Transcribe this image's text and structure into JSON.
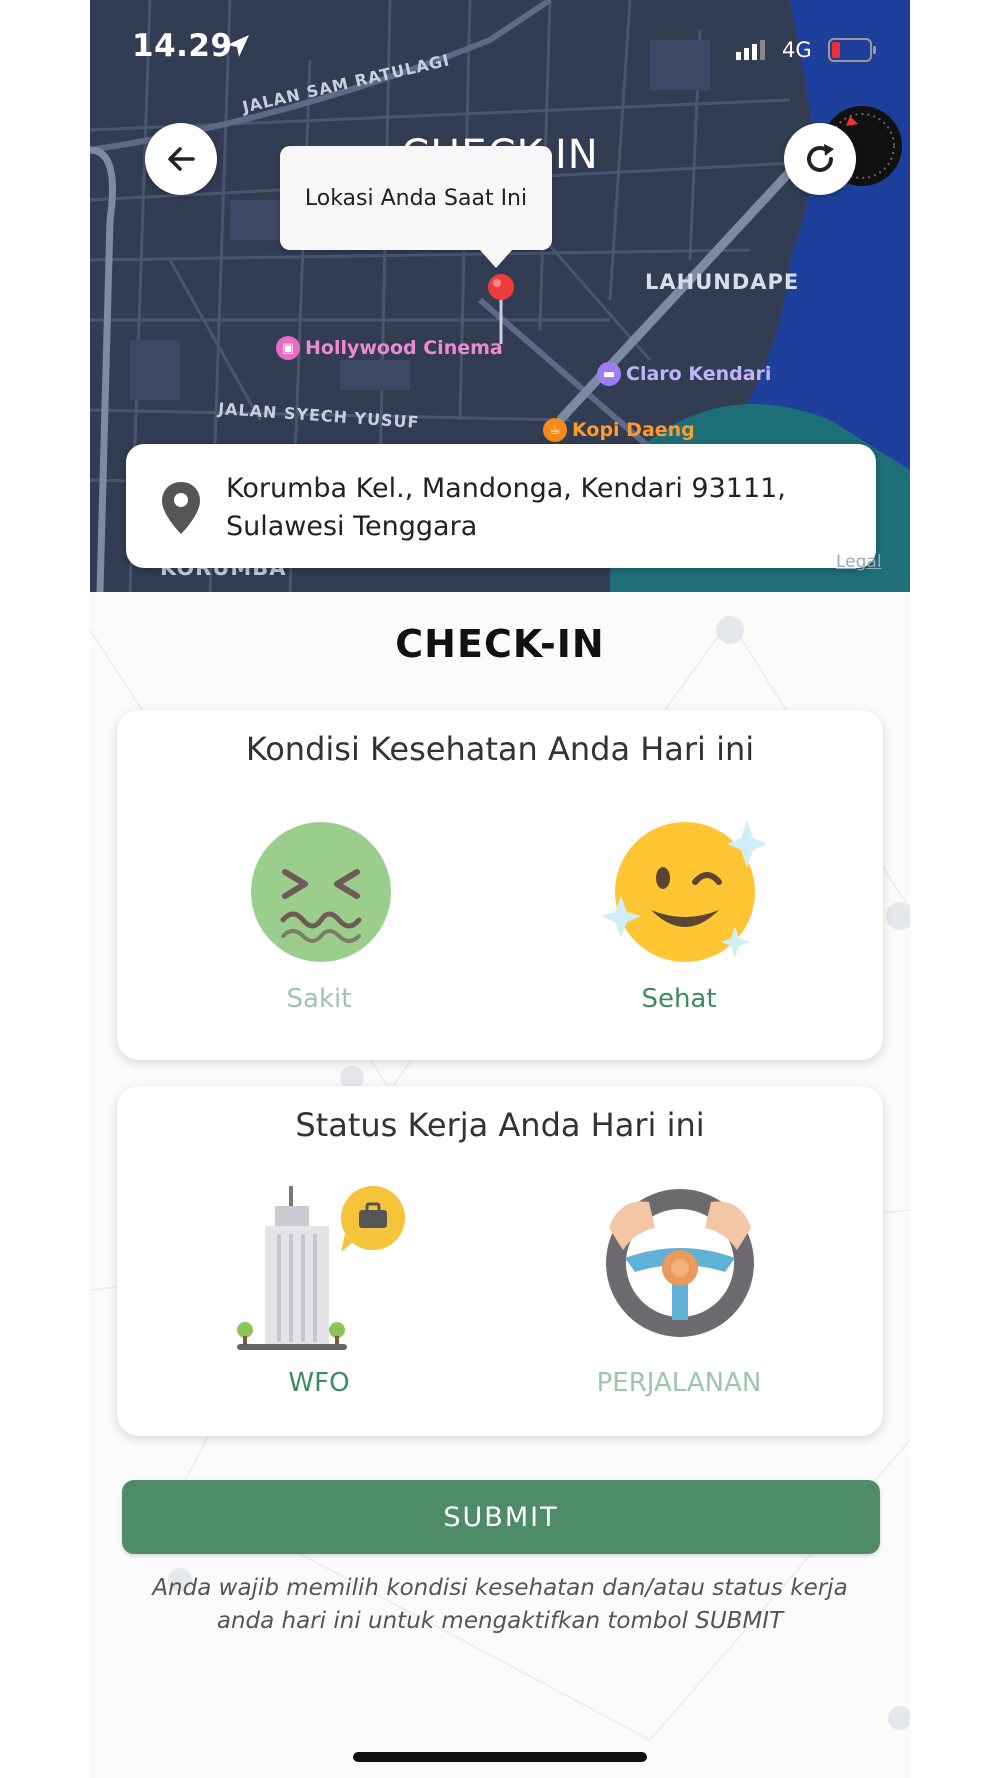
{
  "status_bar": {
    "time": "14.29",
    "network": "4G"
  },
  "header": {
    "title": "CHECK-IN"
  },
  "map": {
    "tooltip": "Lokasi Anda Saat Ini",
    "streets": [
      "JALAN SAM RATULAGI",
      "JALAN SYECH YUSUF",
      "LAHUNDAPE",
      "KORUMBA"
    ],
    "pois": [
      {
        "name": "Hollywood Cinema",
        "color": "#f08ad0"
      },
      {
        "name": "Claro Kendari",
        "color": "#b9a0ff"
      },
      {
        "name": "Kopi Daeng",
        "color": "#ff9a2e"
      }
    ],
    "legal": "Legal"
  },
  "address": "Korumba Kel., Mandonga, Kendari 93111, Sulawesi Tenggara",
  "page_title": "CHECK-IN",
  "health": {
    "title": "Kondisi Kesehatan Anda Hari ini",
    "options": [
      {
        "label": "Sakit"
      },
      {
        "label": "Sehat"
      }
    ]
  },
  "work": {
    "title": "Status Kerja Anda Hari ini",
    "options": [
      {
        "label": "WFO"
      },
      {
        "label": "PERJALANAN"
      }
    ]
  },
  "submit_label": "SUBMIT",
  "note": "Anda wajib memilih kondisi kesehatan dan/atau status kerja anda hari ini untuk mengaktifkan tombol SUBMIT",
  "colors": {
    "accent": "#4e8b68",
    "map_bg": "#323c52",
    "water": "#1f3f9c"
  },
  "icons": [
    "location-arrow-icon",
    "signal-icon",
    "battery-icon",
    "back-arrow-icon",
    "refresh-icon",
    "compass-icon",
    "map-pin-icon",
    "address-pin-icon"
  ]
}
